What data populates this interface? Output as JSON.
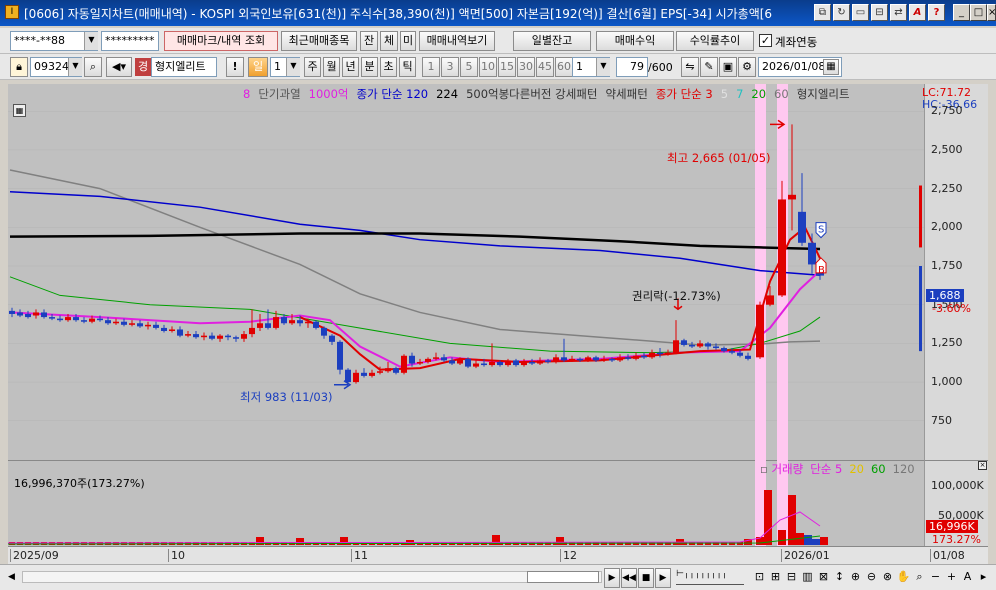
{
  "window": {
    "app_icon": "I",
    "title": "[0606] 자동일지차트(매매내역) - KOSPI 외국인보유[631(천)] 주식수[38,390(천)] 액면[500] 자본금[192(억)] 결산[6월] EPS[-34] 시가총액[6"
  },
  "toolbar1": {
    "account": "****-**88",
    "password": "*********",
    "mark_button": "매매마크/내역 조회",
    "recent_button": "최근매매종목",
    "jan_button": "잔",
    "che_button": "체",
    "mi_button": "미",
    "history_button": "매매내역보기",
    "daily_balance_button": "일별잔고",
    "trade_profit_button": "매매수익",
    "return_button": "수익률추이",
    "account_link_label": "계좌연동",
    "account_link_checked": true
  },
  "toolbar2": {
    "stock_code": "093240",
    "stock_badge": "경",
    "stock_name": "형지엘리트",
    "period_day": "일",
    "period_value": "1",
    "periods": [
      "주",
      "월",
      "년",
      "분",
      "초",
      "틱"
    ],
    "intervals": [
      "1",
      "3",
      "5",
      "10",
      "15",
      "30",
      "45",
      "60"
    ],
    "interval_value": "1",
    "bar_count": "79",
    "bar_total": "/600",
    "date": "2026/01/08"
  },
  "legend": {
    "items": [
      {
        "text": "8",
        "color": "#e020e0"
      },
      {
        "text": "단기과열",
        "color": "#555555"
      },
      {
        "text": "1000억",
        "color": "#e020e0"
      },
      {
        "text": "종가 단순 120",
        "color": "#0000cc"
      },
      {
        "text": "224",
        "color": "#000000"
      },
      {
        "text": "500억봉다른버전 강세패턴",
        "color": "#333333"
      },
      {
        "text": "약세패턴",
        "color": "#333333"
      },
      {
        "text": "종가 단순 3",
        "color": "#e00000"
      },
      {
        "text": "5",
        "color": "#e0e0e0"
      },
      {
        "text": "7",
        "color": "#20c0c0"
      },
      {
        "text": "20",
        "color": "#00a000"
      },
      {
        "text": "60",
        "color": "#777777"
      },
      {
        "text": "형지엘리트",
        "color": "#333333"
      }
    ],
    "lc": "LC:71.72",
    "hc": "HC:-36.66"
  },
  "price_axis": {
    "ticks": [
      "2,750",
      "2,500",
      "2,250",
      "2,000",
      "1,750",
      "1,500",
      "1,250",
      "1,000",
      "750"
    ],
    "current_price": "1,688",
    "current_change": "-3.60%"
  },
  "annotations": {
    "high": "최고 2,665 (01/05)",
    "low": "최저 983 (11/03)",
    "rights": "권리락(-12.73%)",
    "sell_marker": "S",
    "buy_marker": "B"
  },
  "volume": {
    "info": "16,996,370주(173.27%)",
    "legend": [
      {
        "text": "거래량",
        "color": "#e020e0"
      },
      {
        "text": "단순 5",
        "color": "#e020e0"
      },
      {
        "text": "20",
        "color": "#e0c000"
      },
      {
        "text": "60",
        "color": "#00a000"
      },
      {
        "text": "120",
        "color": "#777777"
      }
    ],
    "ticks": [
      "100,000K",
      "50,000K"
    ],
    "current": "16,996K",
    "current_pct": "173.27%"
  },
  "date_axis": {
    "labels": [
      "2025/09",
      "10",
      "11",
      "12",
      "2026/01",
      "01/08"
    ]
  },
  "chart_data": {
    "type": "candlestick",
    "ylim": [
      600,
      2900
    ],
    "moving_averages": [
      "종가 단순 3",
      "5",
      "7",
      "20",
      "60",
      "120",
      "224"
    ],
    "high": 2665,
    "low": 983,
    "current": 1688,
    "change_pct": -3.6
  },
  "colors": {
    "up": "#e00000",
    "down": "#1c3fbf",
    "ma120": "#0000cc",
    "ma224": "#000000",
    "ma60": "#808080",
    "ma20": "#00a000",
    "ma5": "#e020e0",
    "highlight": "#ffc8f0"
  }
}
